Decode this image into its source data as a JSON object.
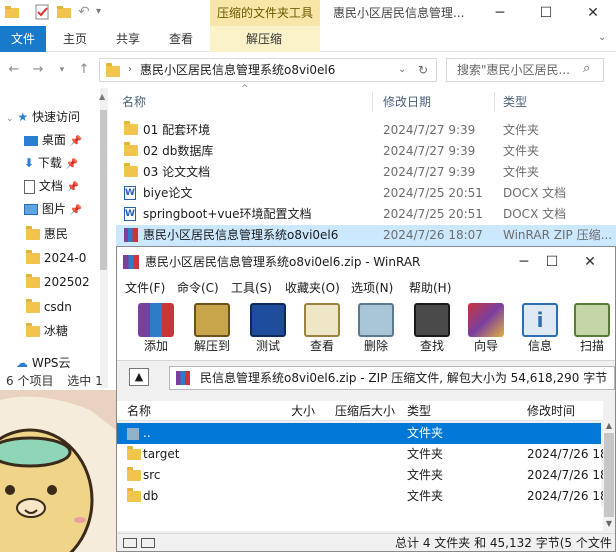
{
  "explorer": {
    "context_tab": "压缩的文件夹工具",
    "window_title": "惠民小区居民信息管理...",
    "ribbon_tabs": [
      "文件",
      "主页",
      "共享",
      "查看",
      "解压缩"
    ],
    "address": "惠民小区居民信息管理系统o8vi0el6",
    "search_placeholder": "搜索\"惠民小区居民...",
    "columns": {
      "name": "名称",
      "date": "修改日期",
      "type": "类型"
    },
    "nav_items": [
      {
        "label": "快速访问",
        "icon": "star-icon"
      },
      {
        "label": "桌面",
        "icon": "desktop-icon"
      },
      {
        "label": "下载",
        "icon": "download-icon"
      },
      {
        "label": "文档",
        "icon": "document-icon"
      },
      {
        "label": "图片",
        "icon": "picture-icon"
      },
      {
        "label": "惠民",
        "icon": "folder-icon"
      },
      {
        "label": "2024-0",
        "icon": "folder-icon"
      },
      {
        "label": "202502",
        "icon": "folder-icon"
      },
      {
        "label": "csdn",
        "icon": "folder-icon"
      },
      {
        "label": "冰糖",
        "icon": "folder-icon"
      },
      {
        "label": "WPS云",
        "icon": "cloud-icon"
      }
    ],
    "files": [
      {
        "name": "01 配套环境",
        "date": "2024/7/27 9:39",
        "type": "文件夹",
        "icon": "folder-icon"
      },
      {
        "name": "02 db数据库",
        "date": "2024/7/27 9:39",
        "type": "文件夹",
        "icon": "folder-icon"
      },
      {
        "name": "03 论文文档",
        "date": "2024/7/27 9:39",
        "type": "文件夹",
        "icon": "folder-icon"
      },
      {
        "name": "biye论文",
        "date": "2024/7/25 20:51",
        "type": "DOCX 文档",
        "icon": "docx-icon"
      },
      {
        "name": "springboot+vue环境配置文档",
        "date": "2024/7/25 20:51",
        "type": "DOCX 文档",
        "icon": "docx-icon"
      },
      {
        "name": "惠民小区居民信息管理系统o8vi0el6",
        "date": "2024/7/26 18:07",
        "type": "WinRAR ZIP 压缩...",
        "icon": "rar-icon"
      }
    ],
    "status_count": "6 个项目",
    "status_selected": "选中 1"
  },
  "winrar": {
    "title": "惠民小区居民信息管理系统o8vi0el6.zip - WinRAR",
    "menu": [
      "文件(F)",
      "命令(C)",
      "工具(S)",
      "收藏夹(O)",
      "选项(N)",
      "帮助(H)"
    ],
    "toolbar": [
      {
        "label": "添加",
        "icon": "add-archive-icon",
        "color": "#7b3fa0"
      },
      {
        "label": "解压到",
        "icon": "extract-to-icon",
        "color": "#8a6d1c"
      },
      {
        "label": "测试",
        "icon": "test-icon",
        "color": "#1e4d9c"
      },
      {
        "label": "查看",
        "icon": "view-icon",
        "color": "#b79b4a"
      },
      {
        "label": "删除",
        "icon": "delete-icon",
        "color": "#8fb3c9"
      },
      {
        "label": "查找",
        "icon": "find-icon",
        "color": "#3a3a3a"
      },
      {
        "label": "向导",
        "icon": "wizard-icon",
        "color": "#b03a7a"
      },
      {
        "label": "信息",
        "icon": "info-icon",
        "color": "#2f6fb0"
      },
      {
        "label": "扫描",
        "icon": "scan-icon",
        "color": "#5a7a3a"
      }
    ],
    "path": "民信息管理系统o8vi0el6.zip - ZIP 压缩文件, 解包大小为 54,618,290 字节",
    "columns": {
      "name": "名称",
      "size": "大小",
      "packed": "压缩后大小",
      "type": "类型",
      "modified": "修改时间"
    },
    "rows": [
      {
        "name": "..",
        "type": "文件夹",
        "date": "",
        "selected": true
      },
      {
        "name": "target",
        "type": "文件夹",
        "date": "2024/7/26 18"
      },
      {
        "name": "src",
        "type": "文件夹",
        "date": "2024/7/26 18"
      },
      {
        "name": "db",
        "type": "文件夹",
        "date": "2024/7/26 18"
      }
    ],
    "status": "总计 4 文件夹 和 45,132 字节(5 个文件"
  }
}
